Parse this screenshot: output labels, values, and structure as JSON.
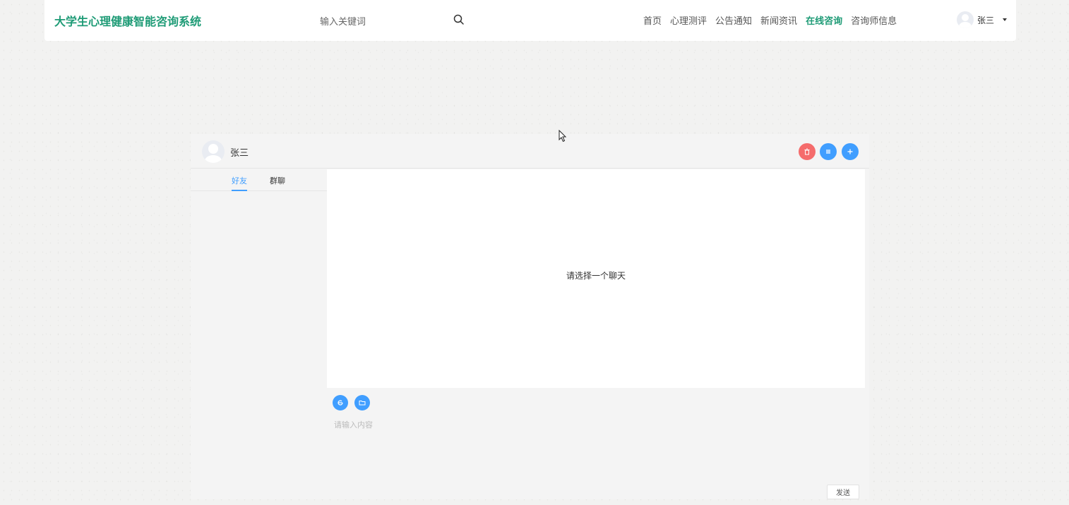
{
  "navbar": {
    "brand": "大学生心理健康智能咨询系统",
    "search_placeholder": "输入关键词",
    "nav_items": [
      {
        "label": "首页",
        "active": false
      },
      {
        "label": "心理测评",
        "active": false
      },
      {
        "label": "公告通知",
        "active": false
      },
      {
        "label": "新闻资讯",
        "active": false
      },
      {
        "label": "在线咨询",
        "active": true
      },
      {
        "label": "咨询师信息",
        "active": false
      }
    ],
    "user_name": "张三"
  },
  "chat": {
    "header_name": "张三",
    "header_buttons": [
      {
        "icon": "delete-icon",
        "color": "#f56c6c"
      },
      {
        "icon": "list-icon",
        "color": "#409eff"
      },
      {
        "icon": "plus-icon",
        "color": "#409eff"
      }
    ],
    "tabs": [
      {
        "label": "好友",
        "active": true
      },
      {
        "label": "群聊",
        "active": false
      }
    ],
    "empty_message": "请选择一个聊天",
    "toolbar": [
      {
        "icon": "emoji-icon"
      },
      {
        "icon": "folder-icon"
      }
    ],
    "input_placeholder": "请输入内容",
    "send_label": "发送"
  },
  "colors": {
    "brand": "#1e9b76",
    "primary": "#409eff",
    "danger": "#f56c6c"
  }
}
